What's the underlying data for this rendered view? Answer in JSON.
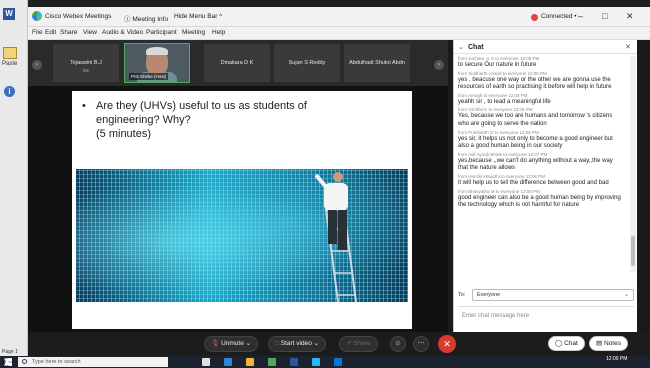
{
  "word": {
    "paste_label": "Paste",
    "page_label": "Page 1"
  },
  "titlebar": {
    "app_title": "Cisco Webex Meetings",
    "meeting_info": "Meeting Info",
    "hide_menu": "Hide Menu Bar ^",
    "status": "Connected •",
    "minimize": "–",
    "restore": "□",
    "close": "✕"
  },
  "menu": [
    "File",
    "Edit",
    "Share",
    "View",
    "Audio & Video",
    "Participant",
    "Meeting",
    "Help"
  ],
  "participants": [
    {
      "name": "Tejaswini B.J",
      "sub": "Me"
    },
    {
      "name": "Dinakara D K",
      "sub": ""
    },
    {
      "name": "Sujan S Reddy",
      "sub": ""
    },
    {
      "name": "Abdulhadi Shukri Abdn",
      "sub": ""
    }
  ],
  "active_speaker": {
    "name": "Priti Shirke (Host)"
  },
  "slide": {
    "lines": [
      "Are they (UHVs) useful to us as students of",
      "engineering? Why?",
      "(5 minutes)"
    ]
  },
  "controls": {
    "unmute": "Unmute",
    "start_video": "Start video",
    "share": "Share",
    "chat": "Chat",
    "notes": "Notes"
  },
  "chat": {
    "title": "Chat",
    "messages": [
      {
        "from": "from sucheta. p. b to everyone   12:05 PM",
        "text": "to secure Our nature in future"
      },
      {
        "from": "from Siddharth Anand to everyone   12:05 PM",
        "text": "yes , beacuse one way or the other we are gonna use the resources of earth so practising it before will help in future"
      },
      {
        "from": "from Amogh to everyone   12:06 PM",
        "text": "yeahh sir , to lead a meaningful life"
      },
      {
        "from": "from Yohitha K to everyone   12:06 PM",
        "text": "Yes, because we too are humans and tomorrow 's citizens who are going to serve the nation"
      },
      {
        "from": "from Prashanth G to everyone   12:06 PM",
        "text": "yes sir, it helps us not only to become a good engineer but also a good human being in our society"
      },
      {
        "from": "from Asif Ayoub Bhatti to everyone   12:07 PM",
        "text": "yes,because ,,we can't do anything without a way,,the way that the nature allows"
      },
      {
        "from": "from Harshini Bujothi to everyone   12:08 PM",
        "text": "it will help us to tell the difference between good and bad"
      },
      {
        "from": "from Bhavyatha M to everyone   12:08 PM",
        "text": "good engineer can also be a good human being by improving the technology which is not harmful for nature"
      }
    ],
    "to_label": "To:",
    "to_value": "Everyone",
    "input_placeholder": "Enter chat message here"
  },
  "taskbar": {
    "search_placeholder": "Type here to search",
    "time": "12:09 PM"
  },
  "colors": {
    "end_call": "#d93a2e",
    "connected": "#d9463a",
    "speaker_border": "#4caf50"
  }
}
